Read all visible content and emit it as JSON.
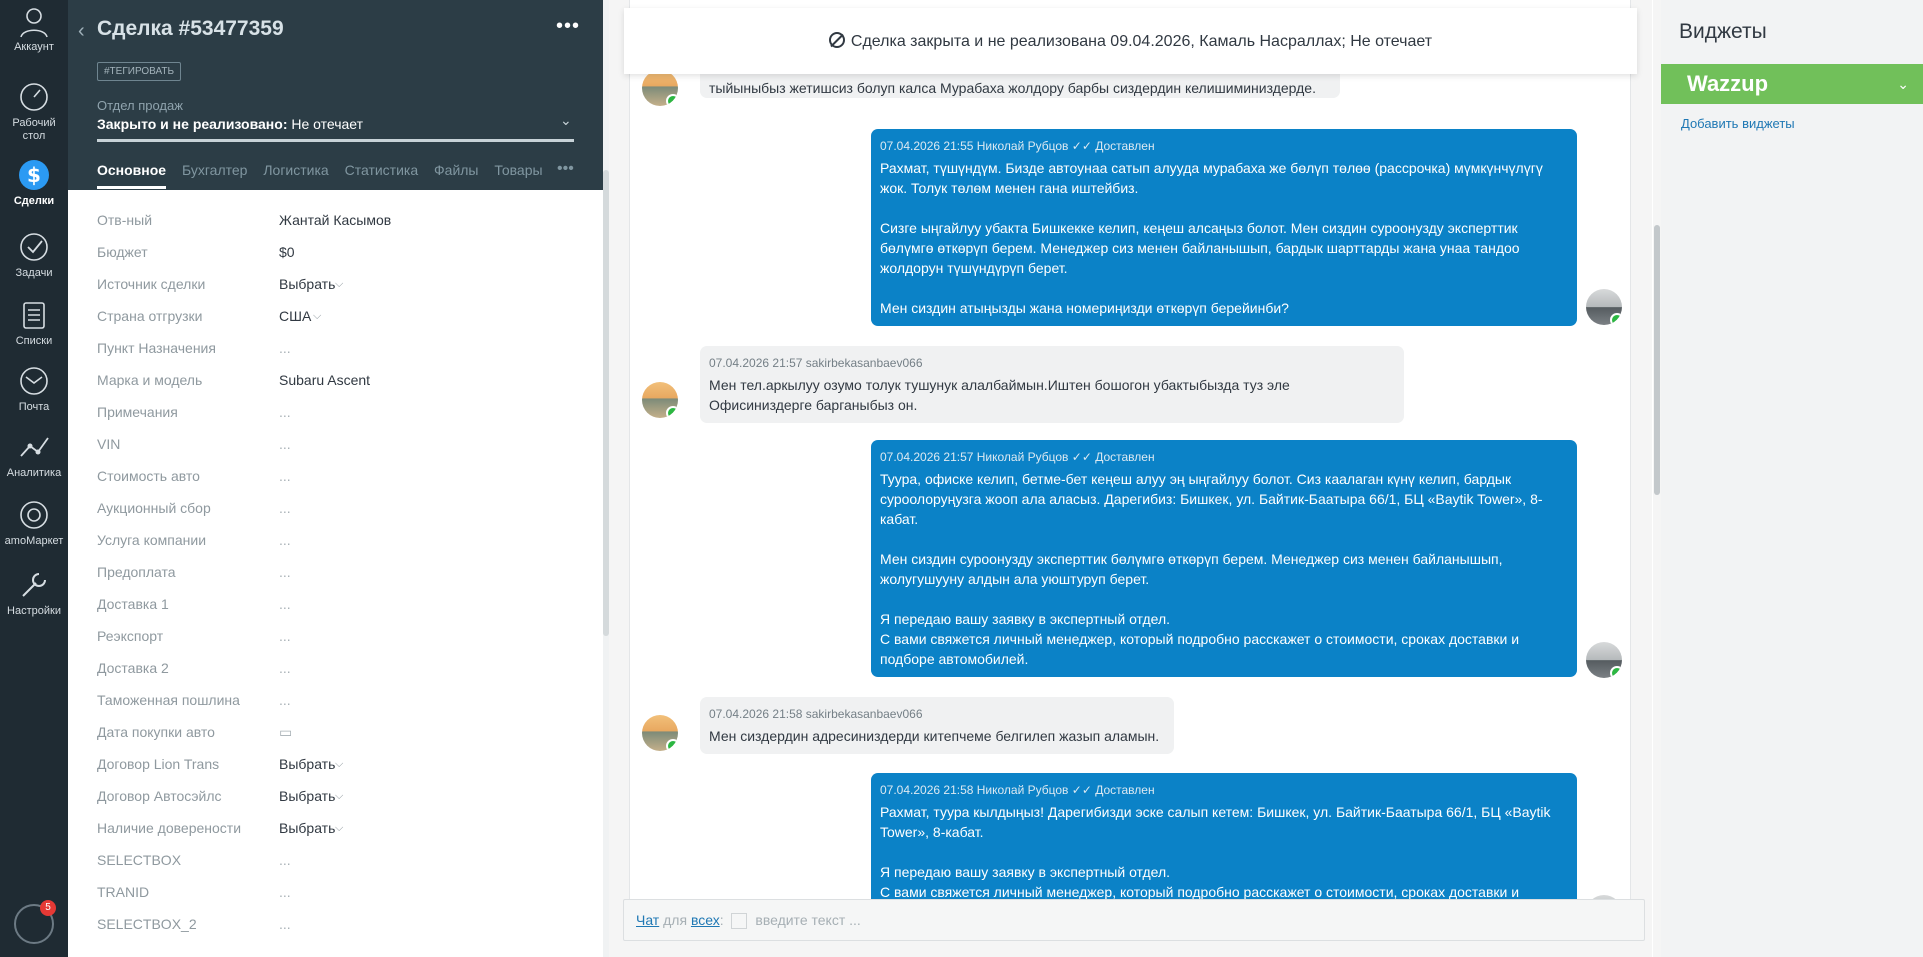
{
  "nav": {
    "items": [
      {
        "label": "Аккаунт",
        "icon": "account-icon"
      },
      {
        "label": "Рабочий стол",
        "icon": "dashboard-icon"
      },
      {
        "label": "Сделки",
        "icon": "deals-icon"
      },
      {
        "label": "Задачи",
        "icon": "tasks-icon"
      },
      {
        "label": "Списки",
        "icon": "lists-icon"
      },
      {
        "label": "Почта",
        "icon": "mail-icon"
      },
      {
        "label": "Аналитика",
        "icon": "analytics-icon"
      },
      {
        "label": "amoМаркет",
        "icon": "market-icon"
      },
      {
        "label": "Настройки",
        "icon": "settings-icon"
      }
    ],
    "notifications_count": "5"
  },
  "card": {
    "title": "Сделка #53477359",
    "tag_button": "#ТЕГИРОВАТЬ",
    "pipeline": "Отдел продаж",
    "status_prefix": "Закрыто и не реализовано:",
    "status_reason": "Не отечает",
    "tabs": [
      "Основное",
      "Бухгалтер",
      "Логистика",
      "Статистика",
      "Файлы",
      "Товары"
    ],
    "fields": [
      {
        "label": "Отв-ный",
        "value": "Жантай Касымов"
      },
      {
        "label": "Бюджет",
        "value": "$0"
      },
      {
        "label": "Источник сделки",
        "value": "Выбрать"
      },
      {
        "label": "Страна отгрузки",
        "value": "США"
      },
      {
        "label": "Пункт Назначения",
        "value": "..."
      },
      {
        "label": "Марка и модель",
        "value": "Subaru Ascent"
      },
      {
        "label": "Примечания",
        "value": "..."
      },
      {
        "label": "VIN",
        "value": "..."
      },
      {
        "label": "Стоимость авто",
        "value": "..."
      },
      {
        "label": "Аукционный сбор",
        "value": "..."
      },
      {
        "label": "Услуга компании",
        "value": "..."
      },
      {
        "label": "Предоплата",
        "value": "..."
      },
      {
        "label": "Доставка 1",
        "value": "..."
      },
      {
        "label": "Реэкспорт",
        "value": "..."
      },
      {
        "label": "Доставка 2",
        "value": "..."
      },
      {
        "label": "Таможенная пошлина",
        "value": "..."
      },
      {
        "label": "Дата покупки авто",
        "value": "▭"
      },
      {
        "label": "Договор Lion Trans",
        "value": "Выбрать"
      },
      {
        "label": "Договор Автосэйлс",
        "value": "Выбрать"
      },
      {
        "label": "Наличие доверености",
        "value": "Выбрать"
      },
      {
        "label": "SELECTBOX",
        "value": "..."
      },
      {
        "label": "TRANID",
        "value": "..."
      },
      {
        "label": "SELECTBOX_2",
        "value": "..."
      }
    ]
  },
  "feed": {
    "closed_banner": "Сделка закрыта и не реализована 09.04.2026, Камаль Насраллах; Не отечает",
    "messages": [
      {
        "dir": "in",
        "meta": "",
        "paragraphs": [
          "тыйыныбыз жетишсиз болуп калса Мурабаха жолдору барбы сиздердин келишиминиздерде."
        ]
      },
      {
        "dir": "out",
        "meta": "07.04.2026 21:55 Николай Рубцов ✓✓ Доставлен",
        "paragraphs": [
          "Рахмат, түшүндүм. Бизде автоунаа сатып алууда мурабаха же бөлүп төлөө (рассрочка) мүмкүнчүлүгү жок. Толук төлөм менен гана иштейбиз.",
          "Сизге ыңгайлуу убакта Бишкекке келип, кеңеш алсаңыз болот. Мен сиздин суроонузду эксперттик бөлүмгө өткөрүп берем. Менеджер сиз менен байланышып, бардык шарттарды жана унаа тандоо жолдорун түшүндүрүп берет.",
          "Мен сиздин атыңызды жана номериңизди өткөрүп берейинби?"
        ]
      },
      {
        "dir": "in",
        "meta": "07.04.2026 21:57 sakirbekasanbaev066",
        "paragraphs": [
          "Мен тел.аркылуу озумо толук тушунук алалбаймын.Иштен бошогон убактыбызда туз эле Офисиниздерге барганыбыз он."
        ]
      },
      {
        "dir": "out",
        "meta": "07.04.2026 21:57 Николай Рубцов ✓✓ Доставлен",
        "paragraphs": [
          "Туура, офиске келип, бетме-бет кеңеш алуу эң ыңгайлуу болот. Сиз каалаган күнү келип, бардык суроолоруңузга жооп ала аласыз. Дарегибиз: Бишкек, ул. Байтик-Баатыра 66/1, БЦ «Baytik Tower», 8-кабат.",
          "Мен сиздин суроонузду эксперттик бөлүмгө өткөрүп берем. Менеджер сиз менен байланышып, жолугушууну алдын ала уюштуруп берет.",
          "Я передаю вашу заявку в экспертный отдел.\nС вами свяжется личный менеджер, который подробно расскажет о стоимости, сроках доставки и подборе автомобилей."
        ]
      },
      {
        "dir": "in",
        "meta": "07.04.2026 21:58 sakirbekasanbaev066",
        "paragraphs": [
          "Мен сиздердин адресиниздерди китепчеме белгилеп жазып аламын."
        ]
      },
      {
        "dir": "out",
        "meta": "07.04.2026 21:58 Николай Рубцов ✓✓ Доставлен",
        "paragraphs": [
          "Рахмат, туура кылдыңыз! Дарегибизди эске салып кетем: Бишкек, ул. Байтик-Баатыра 66/1, БЦ «Baytik Tower», 8-кабат.",
          "Я передаю вашу заявку в экспертный отдел.\nС вами свяжется личный менеджер, который подробно расскажет о стоимости, сроках доставки и"
        ]
      }
    ],
    "composer": {
      "chat": "Чат",
      "for": "для",
      "all": "всех",
      "colon": ":",
      "placeholder": "введите текст ..."
    }
  },
  "widgets": {
    "title": "Виджеты",
    "wazzup": "Wazzup",
    "add": "Добавить виджеты"
  }
}
